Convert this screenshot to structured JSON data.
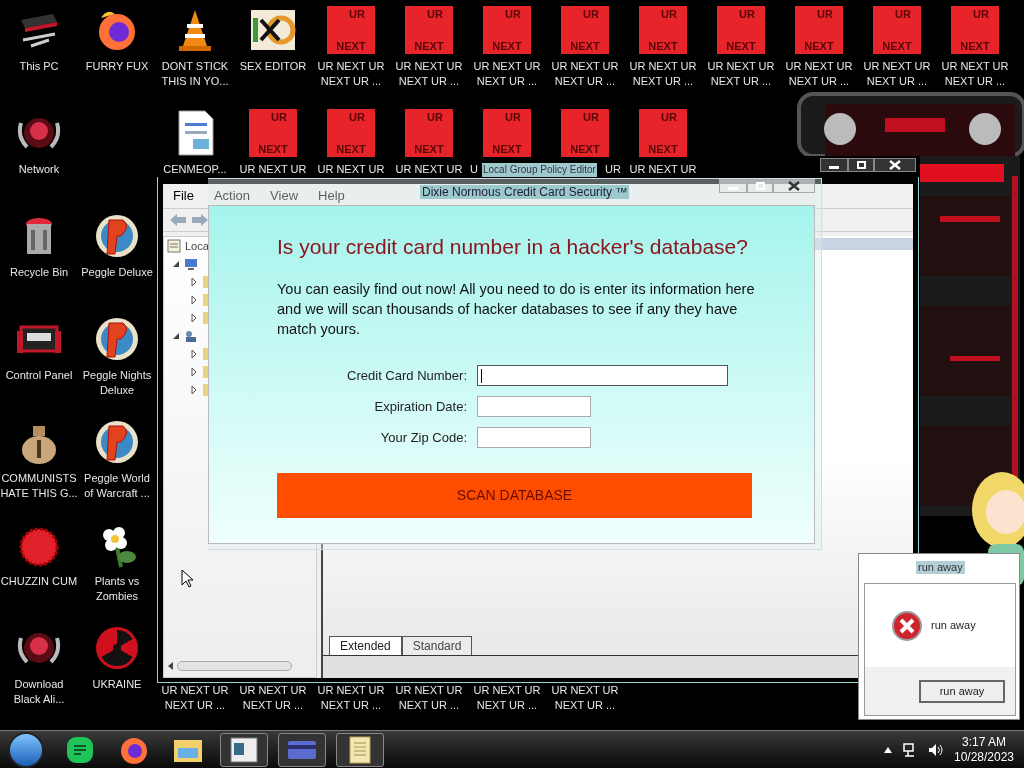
{
  "desktop": {
    "icon_rows": [
      [
        {
          "label": "This PC",
          "kind": "pc"
        },
        {
          "label": "FURRY FUX",
          "kind": "firefox"
        },
        {
          "label": "DONT STICK THIS IN YO...",
          "kind": "cone"
        },
        {
          "label": "SEX EDITOR",
          "kind": "hex"
        },
        {
          "label": "UR NEXT UR NEXT UR ...",
          "kind": "ur",
          "image_text": [
            "UR",
            "NEXT"
          ]
        },
        {
          "label": "UR NEXT UR NEXT UR ...",
          "kind": "ur",
          "image_text": [
            "UR",
            "NEXT"
          ]
        },
        {
          "label": "UR NEXT UR NEXT UR ...",
          "kind": "ur",
          "image_text": [
            "UR",
            "NEXT"
          ]
        },
        {
          "label": "UR NEXT UR NEXT UR ...",
          "kind": "ur",
          "image_text": [
            "UR",
            "NEXT"
          ]
        },
        {
          "label": "UR NEXT UR NEXT UR ...",
          "kind": "ur",
          "image_text": [
            "UR",
            "NEXT"
          ]
        },
        {
          "label": "UR NEXT UR NEXT UR ...",
          "kind": "ur",
          "image_text": [
            "UR",
            "NEXT"
          ]
        },
        {
          "label": "UR NEXT UR NEXT UR ...",
          "kind": "ur",
          "image_text": [
            "UR",
            "NEXT"
          ]
        },
        {
          "label": "UR NEXT UR NEXT UR ...",
          "kind": "ur",
          "image_text": [
            "UR",
            "NEXT"
          ]
        },
        {
          "label": "UR NEXT UR NEXT UR ...",
          "kind": "ur",
          "image_text": [
            "UR",
            "NEXT"
          ]
        }
      ],
      [
        {
          "label": "Network",
          "kind": "alien"
        },
        {
          "label": "CENMEOP...",
          "kind": "document"
        },
        {
          "label": "UR NEXT UR",
          "kind": "ur",
          "image_text": [
            "UR",
            "NEXT"
          ]
        },
        {
          "label": "UR NEXT UR",
          "kind": "ur",
          "image_text": [
            "UR",
            "NEXT"
          ]
        },
        {
          "label": "UR NEXT UR",
          "kind": "ur",
          "image_text": [
            "UR",
            "NEXT"
          ]
        },
        {
          "label": "U",
          "kind": "ur",
          "image_text": [
            "UR",
            "NEXT"
          ]
        },
        {
          "label": "UR",
          "kind": "ur",
          "image_text": [
            "UR",
            "NEXT"
          ]
        },
        {
          "label": "UR NEXT UR",
          "kind": "ur",
          "image_text": [
            "UR",
            "NEXT"
          ]
        }
      ],
      [
        {
          "label": "Recycle Bin",
          "kind": "recycle"
        },
        {
          "label": "Peggle Deluxe",
          "kind": "peggle"
        }
      ],
      [
        {
          "label": "Control Panel",
          "kind": "control"
        },
        {
          "label": "Peggle Nights Deluxe",
          "kind": "peggle"
        }
      ],
      [
        {
          "label": "COMMUNISTS HATE THIS G...",
          "kind": "money"
        },
        {
          "label": "Peggle World of Warcraft ...",
          "kind": "peggle"
        }
      ],
      [
        {
          "label": "CHUZZIN CUM",
          "kind": "chuzzle"
        },
        {
          "label": "Plants vs Zombies",
          "kind": "plants"
        }
      ],
      [
        {
          "label": "Download Black Ali...",
          "kind": "alien"
        },
        {
          "label": "UKRAINE",
          "kind": "radiation"
        },
        {
          "label": "UR NEXT UR NEXT UR ...",
          "kind": "label_only"
        },
        {
          "label": "UR NEXT UR NEXT UR ...",
          "kind": "label_only"
        },
        {
          "label": "UR NEXT UR NEXT UR ...",
          "kind": "label_only"
        },
        {
          "label": "UR NEXT UR NEXT UR ...",
          "kind": "label_only"
        },
        {
          "label": "UR NEXT UR NEXT UR ...",
          "kind": "label_only"
        },
        {
          "label": "UR NEXT UR NEXT UR ...",
          "kind": "label_only"
        }
      ]
    ]
  },
  "policy_window": {
    "tooltip": "Local Group Policy Editor",
    "menu": [
      "File",
      "Action",
      "View",
      "Help"
    ],
    "tree_root": "Loca",
    "tree": [
      {
        "kind": "computer",
        "expanded": true,
        "children": [
          {
            "expanded": false
          },
          {
            "expanded": false
          },
          {
            "expanded": false
          }
        ]
      },
      {
        "kind": "user",
        "expanded": true,
        "children": [
          {
            "expanded": false
          },
          {
            "expanded": false
          },
          {
            "expanded": false
          }
        ]
      }
    ],
    "tabs": [
      {
        "label": "Extended",
        "selected": true
      },
      {
        "label": "Standard",
        "selected": false
      }
    ]
  },
  "card_window": {
    "title": "Dixie Normous Credit Card Security ™",
    "heading": "Is your credit card number in a hacker's database?",
    "body": "You can easily find out now! All you need to do is enter its information here and we will scan thousands of hacker databases to see if any they have match yours.",
    "fields": [
      {
        "label": "Credit Card Number:",
        "focused": true
      },
      {
        "label": "Expiration Date:",
        "focused": false
      },
      {
        "label": "Your Zip Code:",
        "focused": false
      }
    ],
    "button": "SCAN DATABASE"
  },
  "error_dialog": {
    "title": "run away",
    "message": "run away",
    "button": "run away"
  },
  "taskbar": {
    "apps": [
      {
        "kind": "chat",
        "open": false
      },
      {
        "kind": "firefox",
        "open": false
      },
      {
        "kind": "folder",
        "open": false
      },
      {
        "kind": "console",
        "open": true
      },
      {
        "kind": "card",
        "open": true
      },
      {
        "kind": "notes",
        "open": true
      }
    ],
    "time": "3:17 AM",
    "date": "10/28/2023"
  }
}
